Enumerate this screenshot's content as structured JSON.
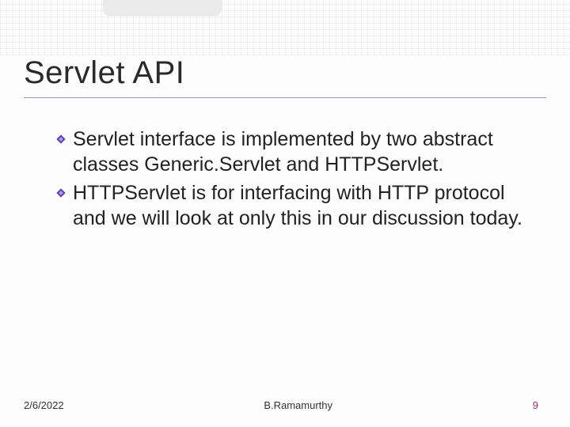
{
  "title": "Servlet API",
  "bullets": [
    "Servlet interface is implemented by two abstract classes Generic.Servlet and HTTPServlet.",
    "HTTPServlet is for interfacing with HTTP protocol and we will look at only this in our discussion today."
  ],
  "footer": {
    "date": "2/6/2022",
    "author": "B.Ramamurthy",
    "page": "9"
  },
  "icons": {
    "bullet": "diamond-bullet-icon"
  }
}
